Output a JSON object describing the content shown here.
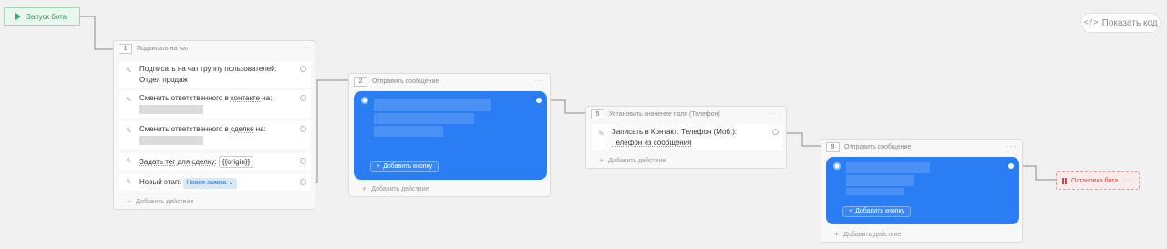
{
  "start": {
    "label": "Запуск бота"
  },
  "toolbar": {
    "show_code_label": "Показать код",
    "code_icon": "</>"
  },
  "block1": {
    "number": "1",
    "title": "Подписать на чат",
    "rows": [
      {
        "line1": "Подписать на чат группу пользователей:",
        "line2": "Отдел продаж"
      },
      {
        "prefix": "Сменить ответственного в ",
        "link": "контакте",
        "suffix": " на:"
      },
      {
        "prefix": "Сменить ответственного в ",
        "link": "сделке",
        "suffix": " на:"
      },
      {
        "label": "Задать тег для сделку:",
        "tag": "{{origin}}"
      },
      {
        "label": "Новый этап:",
        "stage": "Новая заявка"
      }
    ],
    "add_action": "Добавить действие"
  },
  "block2": {
    "number": "2",
    "title": "Отправить сообщение",
    "add_button": "Добавить кнопку",
    "add_action": "Добавить действие"
  },
  "block5": {
    "number": "5",
    "title": "Установить значение поля (Телефон)",
    "row_line1": "Записать в Контакт: Телефон (Моб.):",
    "row_line2": "Телефон из сообщения",
    "add_action": "Добавить действие"
  },
  "block9": {
    "number": "9",
    "title": "Отправить сообщение",
    "add_button": "Добавить кнопку",
    "add_action": "Добавить действие"
  },
  "stop": {
    "label": "Остановка бота"
  },
  "menu_glyph": "···",
  "colors": {
    "accent_blue": "#2b7df3",
    "start_green": "#2fb35f",
    "stop_red": "#d64545"
  }
}
